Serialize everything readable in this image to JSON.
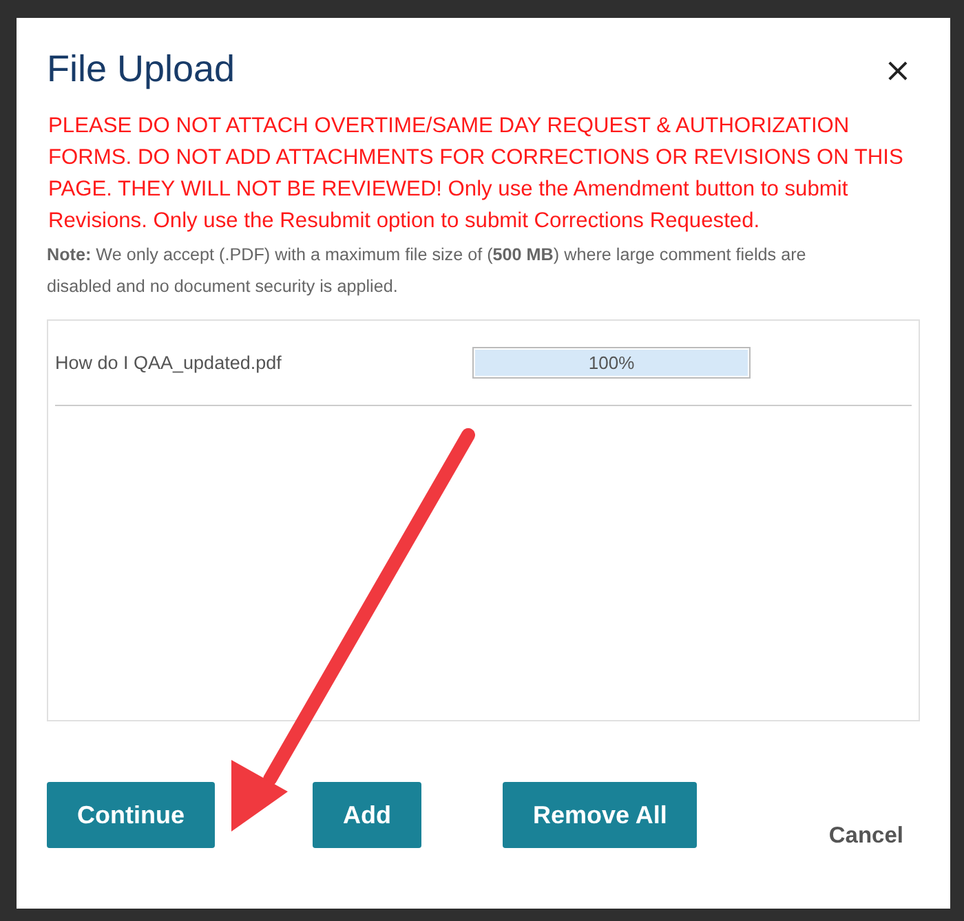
{
  "dialog": {
    "title": "File Upload",
    "close": "×",
    "warning": "PLEASE DO NOT ATTACH OVERTIME/SAME DAY REQUEST & AUTHORIZATION FORMS. DO NOT ADD ATTACHMENTS FOR CORRECTIONS OR REVISIONS ON THIS PAGE. THEY WILL NOT BE REVIEWED! Only use the Amendment button to submit Revisions. Only use the Resubmit option to submit Corrections Requested.",
    "note": "**Note:** We only accept (.PDF) with a maximum file size of (**500 MB**) where large comment fields are disabled and no document security is applied.",
    "files": [
      {
        "name": "How do I QAA_updated.pdf",
        "level": 1,
        "reading": "100%"
      }
    ],
    "buttons": [
      {
        "label": "Continue",
        "kind": "primary"
      },
      {
        "label": "Add",
        "kind": "primary"
      },
      {
        "label": "Remove All",
        "kind": "primary"
      },
      {
        "label": "Cancel",
        "kind": "link"
      }
    ]
  }
}
